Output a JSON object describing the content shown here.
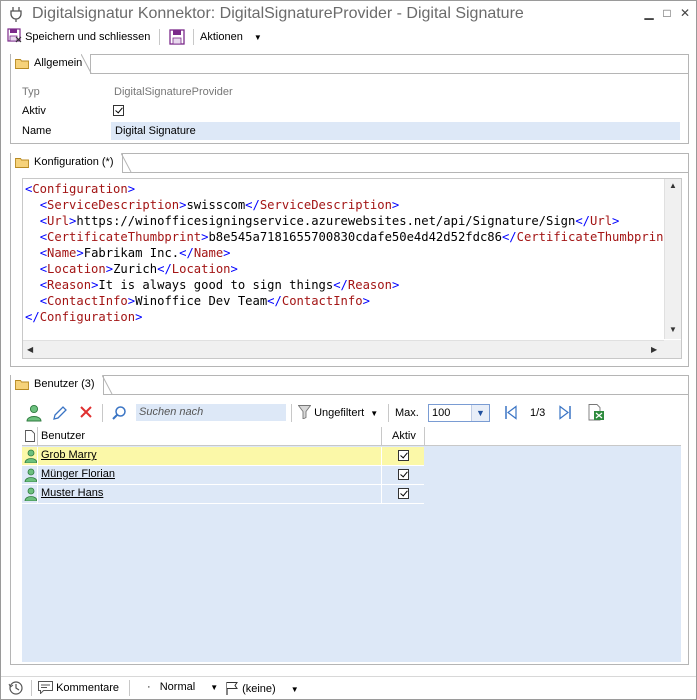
{
  "window": {
    "title": "Digitalsignatur Konnektor: DigitalSignatureProvider - Digital Signature",
    "min_glyph": "▁",
    "max_glyph": "□",
    "close_glyph": "✕"
  },
  "toolbar": {
    "save_close_label": "Speichern und schliessen",
    "actions_label": "Aktionen"
  },
  "general": {
    "tab_label": "Allgemein",
    "type_label": "Typ",
    "type_value": "DigitalSignatureProvider",
    "active_label": "Aktiv",
    "active_checked": true,
    "name_label": "Name",
    "name_value": "Digital Signature"
  },
  "config": {
    "tab_label": "Konfiguration (*)",
    "lines": [
      {
        "indent": "",
        "open": "Configuration",
        "text": "",
        "close": ""
      },
      {
        "indent": "  ",
        "open": "ServiceDescription",
        "text": "swisscom",
        "close": "ServiceDescription"
      },
      {
        "indent": "  ",
        "open": "Url",
        "text": "https://winofficesigningservice.azurewebsites.net/api/Signature/Sign",
        "close": "Url"
      },
      {
        "indent": "  ",
        "open": "CertificateThumbprint",
        "text": "b8e545a7181655700830cdafe50e4d42d52fdc86",
        "close": "CertificateThumbprint"
      },
      {
        "indent": "  ",
        "open": "Name",
        "text": "Fabrikam Inc.",
        "close": "Name"
      },
      {
        "indent": "  ",
        "open": "Location",
        "text": "Zurich",
        "close": "Location"
      },
      {
        "indent": "  ",
        "open": "Reason",
        "text": "It is always good to sign things",
        "close": "Reason"
      },
      {
        "indent": "  ",
        "open": "ContactInfo",
        "text": "Winoffice Dev Team",
        "close": "ContactInfo"
      },
      {
        "indent": "",
        "open": "",
        "text": "",
        "close": "Configuration"
      }
    ]
  },
  "users": {
    "tab_label": "Benutzer (3)",
    "search_placeholder": "Suchen nach",
    "filter_label": "Ungefiltert",
    "max_label": "Max.",
    "max_value": "100",
    "page_indicator": "1/3",
    "columns": [
      "Benutzer",
      "Aktiv"
    ],
    "rows": [
      {
        "name": "Grob Marry",
        "active": true,
        "selected": true
      },
      {
        "name": "Münger Florian",
        "active": true,
        "selected": false
      },
      {
        "name": "Muster Hans",
        "active": true,
        "selected": false
      }
    ]
  },
  "statusbar": {
    "comments_label": "Kommentare",
    "priority_label": "Normal",
    "flag_label": "(keine)"
  },
  "colors": {
    "field_bg": "#dde8f7",
    "selected_row": "#fbf8a8",
    "xml_tag": "#a31515",
    "xml_bracket": "#0000ff"
  }
}
